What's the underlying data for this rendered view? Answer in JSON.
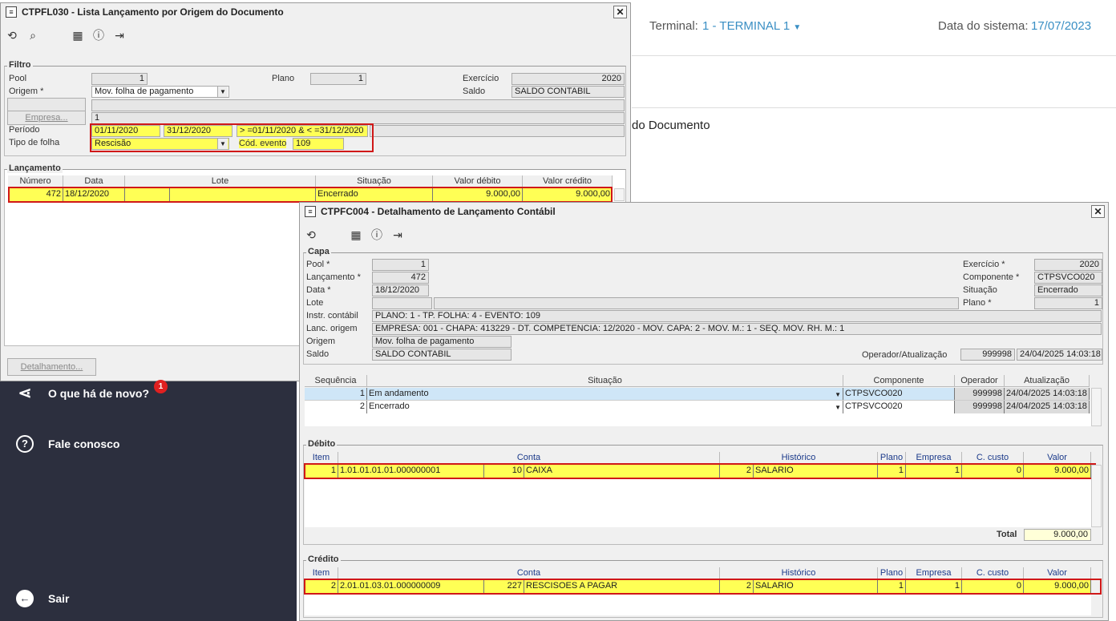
{
  "header": {
    "terminal_label": "Terminal:",
    "terminal_value": "1 - TERMINAL 1",
    "date_label": "Data do sistema:",
    "date_value": "17/07/2023",
    "doc_fragment": "do Documento"
  },
  "win1": {
    "title": "CTPFL030 - Lista Lançamento por Origem do Documento",
    "filtro_label": "Filtro",
    "pool_label": "Pool",
    "pool_value": "1",
    "plano_label": "Plano",
    "plano_value": "1",
    "exercicio_label": "Exercício",
    "exercicio_value": "2020",
    "origem_label": "Origem *",
    "origem_value": "Mov. folha de pagamento",
    "saldo_label": "Saldo",
    "saldo_value": "SALDO CONTABIL",
    "empresa_button": "Empresa...",
    "empresa_value": "1",
    "periodo_label": "Período",
    "periodo_from": "01/11/2020",
    "periodo_to": "31/12/2020",
    "periodo_expr": "> =01/11/2020 & < =31/12/2020",
    "tipo_label": "Tipo de folha",
    "tipo_value": "Rescisão",
    "cod_label": "Cód. evento",
    "cod_value": "109",
    "lanc_label": "Lançamento",
    "cols": [
      "Número",
      "Data",
      "Lote",
      "Situação",
      "Valor débito",
      "Valor crédito"
    ],
    "row": {
      "numero": "472",
      "data": "18/12/2020",
      "lote": "",
      "situacao": "Encerrado",
      "debito": "9.000,00",
      "credito": "9.000,00"
    },
    "detalhe_button": "Detalhamento..."
  },
  "sidebar": {
    "items": [
      {
        "label": "O que há de novo?",
        "badge": "1"
      },
      {
        "label": "Fale conosco"
      },
      {
        "label": "Sair"
      }
    ]
  },
  "win2": {
    "title": "CTPFC004 - Detalhamento de Lançamento Contábil",
    "capa_label": "Capa",
    "pool_label": "Pool *",
    "pool_value": "1",
    "lanc_label": "Lançamento *",
    "lanc_value": "472",
    "data_label": "Data *",
    "data_value": "18/12/2020",
    "lote_label": "Lote",
    "instr_label": "Instr. contábil",
    "instr_value": "PLANO: 1 - TP. FOLHA: 4 - EVENTO: 109",
    "lorig_label": "Lanc. origem",
    "lorig_value": "EMPRESA: 001 - CHAPA: 413229 - DT. COMPETENCIA: 12/2020 - MOV. CAPA: 2 - MOV. M.: 1 - SEQ. MOV. RH. M.: 1",
    "origem_label": "Origem",
    "origem_value": "Mov. folha de pagamento",
    "saldo_label": "Saldo",
    "saldo_value": "SALDO CONTABIL",
    "exercicio_label": "Exercício *",
    "exercicio_value": "2020",
    "comp_label": "Componente *",
    "comp_value": "CTPSVCO020",
    "sit_label": "Situação",
    "sit_value": "Encerrado",
    "plano_label": "Plano *",
    "plano_value": "1",
    "oper_label": "Operador/Atualização",
    "oper_value": "999998",
    "oper_date": "24/04/2025 14:03:18",
    "seq_cols": [
      "Sequência",
      "Situação",
      "Componente",
      "Operador",
      "Atualização"
    ],
    "seq_rows": [
      {
        "seq": "1",
        "sit": "Em andamento",
        "comp": "CTPSVCO020",
        "oper": "999998",
        "atual": "24/04/2025 14:03:18"
      },
      {
        "seq": "2",
        "sit": "Encerrado",
        "comp": "CTPSVCO020",
        "oper": "999998",
        "atual": "24/04/2025 14:03:18"
      }
    ],
    "debito_label": "Débito",
    "credito_label": "Crédito",
    "mov_cols": [
      "Item",
      "Conta",
      "Histórico",
      "Plano",
      "Empresa",
      "C. custo",
      "Valor"
    ],
    "debito_row": {
      "item": "1",
      "conta": "1.01.01.01.01.000000001",
      "cod": "10",
      "desc": "CAIXA",
      "hist_cod": "2",
      "hist": "SALARIO",
      "plano": "1",
      "empresa": "1",
      "ccusto": "0",
      "valor": "9.000,00"
    },
    "total_label": "Total",
    "total_value": "9.000,00",
    "credito_row": {
      "item": "2",
      "conta": "2.01.01.03.01.000000009",
      "cod": "227",
      "desc": "RESCISOES A PAGAR",
      "hist_cod": "2",
      "hist": "SALARIO",
      "plano": "1",
      "empresa": "1",
      "ccusto": "0",
      "valor": "9.000,00"
    }
  }
}
